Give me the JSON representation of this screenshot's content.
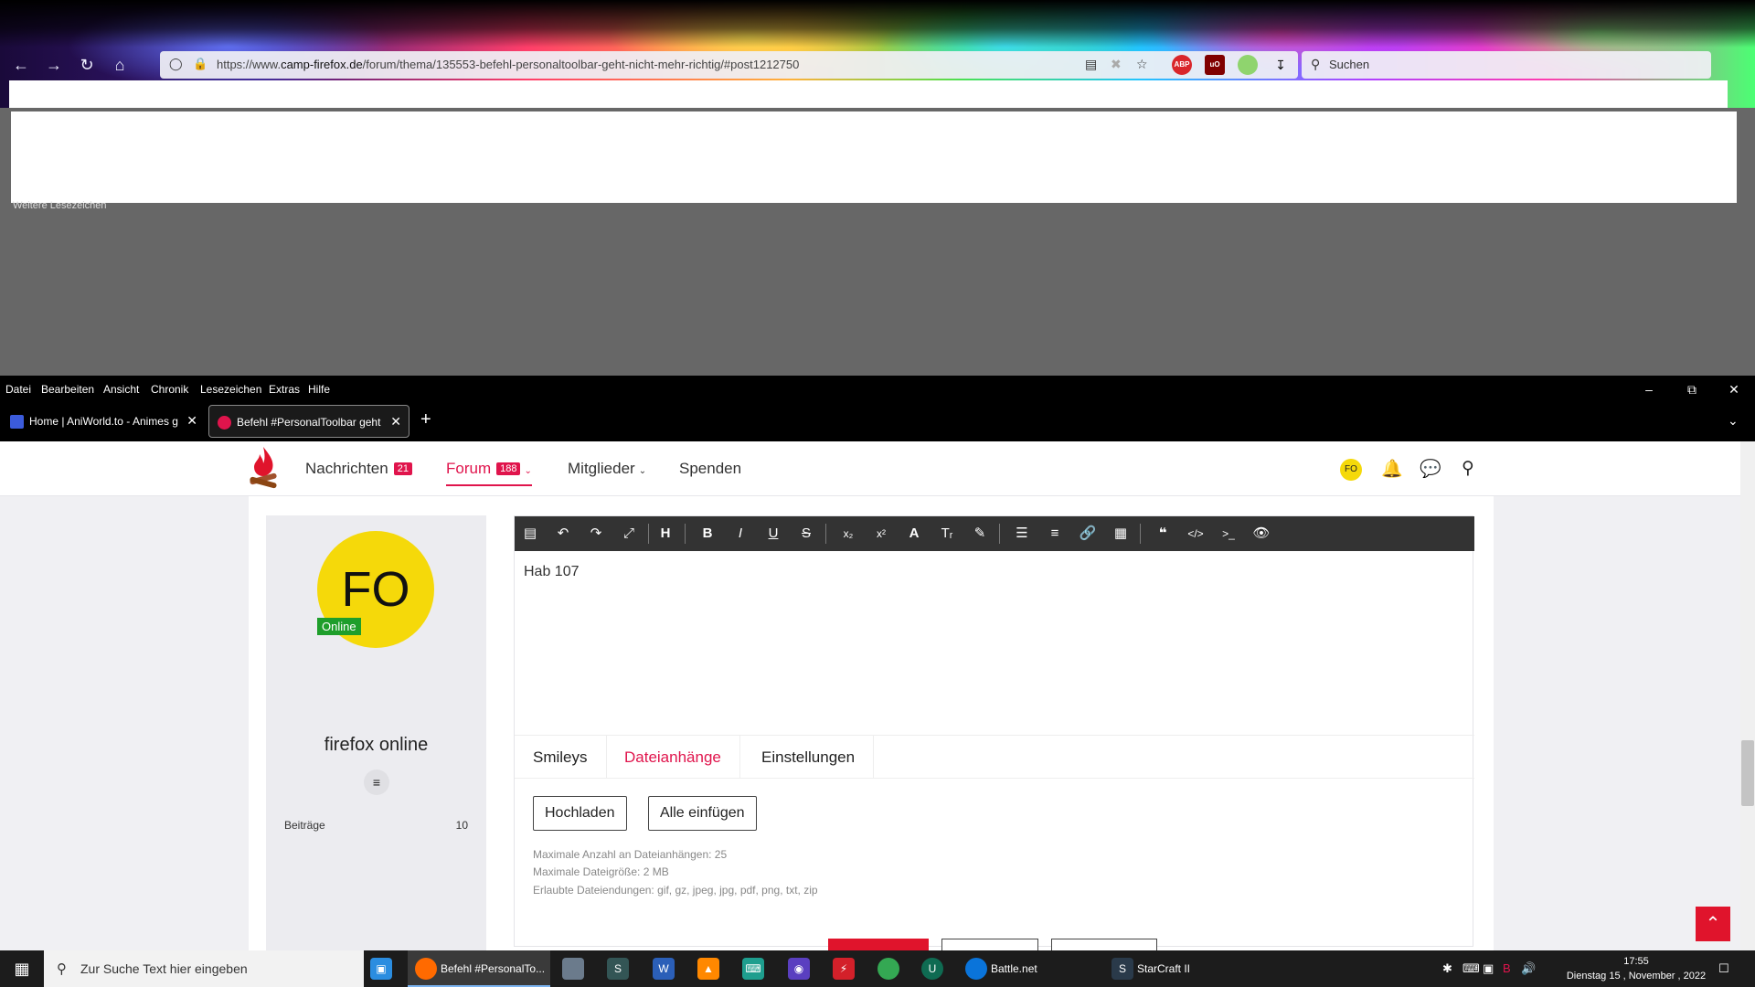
{
  "browser": {
    "url_prefix": "https://www.",
    "url_domain": "camp-firefox.de",
    "url_path": "/forum/thema/135553-befehl-personaltoolbar-geht-nicht-mehr-richtig/#post1212750",
    "search_placeholder": "Suchen",
    "more_bookmarks": "Weitere Lesezeichen",
    "menu": [
      "Datei",
      "Bearbeiten",
      "Ansicht",
      "Chronik",
      "Lesezeichen",
      "Extras",
      "Hilfe"
    ],
    "tabs": [
      {
        "label": "Home | AniWorld.to - Animes g",
        "active": false
      },
      {
        "label": "Befehl #PersonalToolbar geht n",
        "active": true
      }
    ],
    "ext_abp": "ABP",
    "ext_ub": "uO"
  },
  "site": {
    "nav": {
      "nachrichten": "Nachrichten",
      "nachrichten_count": "21",
      "forum": "Forum",
      "forum_count": "188",
      "mitglieder": "Mitglieder",
      "spenden": "Spenden"
    },
    "user_initials": "FO"
  },
  "profile": {
    "initials": "FO",
    "status": "Online",
    "name": "firefox online",
    "posts_label": "Beiträge",
    "posts_value": "10"
  },
  "editor": {
    "text": "Hab 107",
    "tabs": [
      "Smileys",
      "Dateianhänge",
      "Einstellungen"
    ],
    "active_tab": "Dateianhänge",
    "upload_button": "Hochladen",
    "insert_all_button": "Alle einfügen",
    "info_max_count": "Maximale Anzahl an Dateianhängen: 25",
    "info_max_size": "Maximale Dateigröße: 2 MB",
    "info_extensions": "Erlaubte Dateiendungen: gif, gz, jpeg, jpg, pdf, png, txt, zip"
  },
  "taskbar": {
    "search_placeholder": "Zur Suche Text hier eingeben",
    "apps": [
      {
        "label": "Befehl #PersonalTo...",
        "active": true
      },
      {
        "label": "Battle.net",
        "active": false
      },
      {
        "label": "StarCraft II",
        "active": false
      }
    ],
    "time": "17:55",
    "date": "Dienstag 15 , November , 2022"
  },
  "colors": {
    "accent": "#e0144c",
    "online": "#1e9e2b",
    "avatar": "#f5d90a",
    "toolbar": "#333333"
  }
}
